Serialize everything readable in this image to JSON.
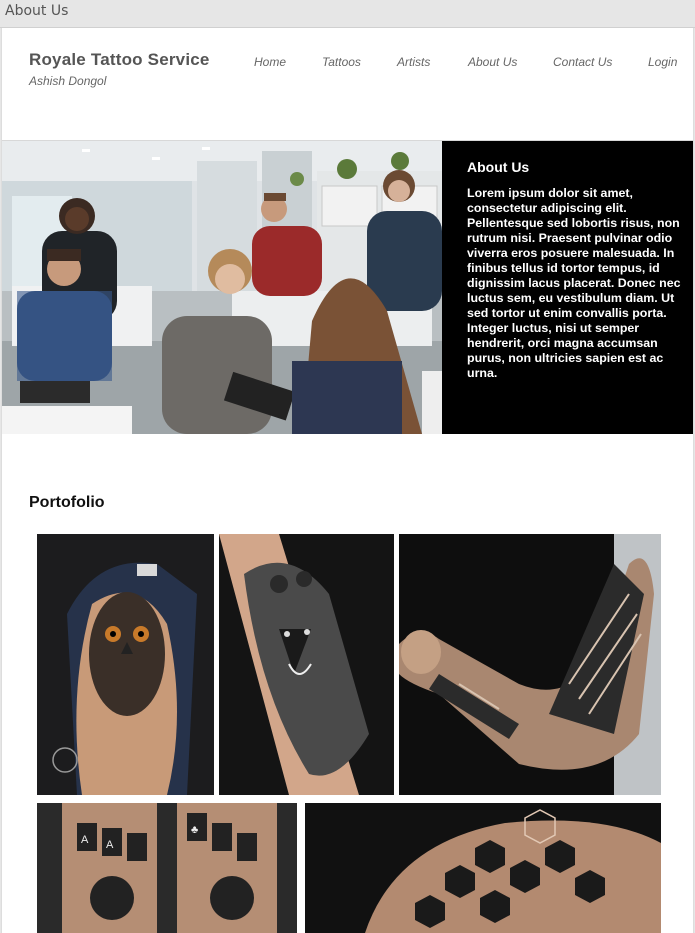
{
  "window": {
    "title": "About Us"
  },
  "brand": {
    "title": "Royale Tattoo Service",
    "subtitle": "Ashish Dongol"
  },
  "nav": {
    "items": [
      {
        "label": "Home"
      },
      {
        "label": "Tattoos"
      },
      {
        "label": "Artists"
      },
      {
        "label": "About Us"
      },
      {
        "label": "Contact Us"
      },
      {
        "label": "Login"
      }
    ]
  },
  "about": {
    "title": "About Us",
    "body": "Lorem ipsum dolor sit amet, consectetur adipiscing elit. Pellentesque sed lobortis risus, non rutrum nisi. Praesent pulvinar odio viverra eros posuere malesuada. In finibus tellus id tortor tempus, id dignissim lacus placerat. Donec nec luctus sem, eu vestibulum diam. Ut sed tortor ut enim convallis porta. Integer luctus, nisi ut semper hendrerit, orci magna accumsan purus, non ultricies sapien est ac urna."
  },
  "portfolio": {
    "title": "Portofolio"
  }
}
